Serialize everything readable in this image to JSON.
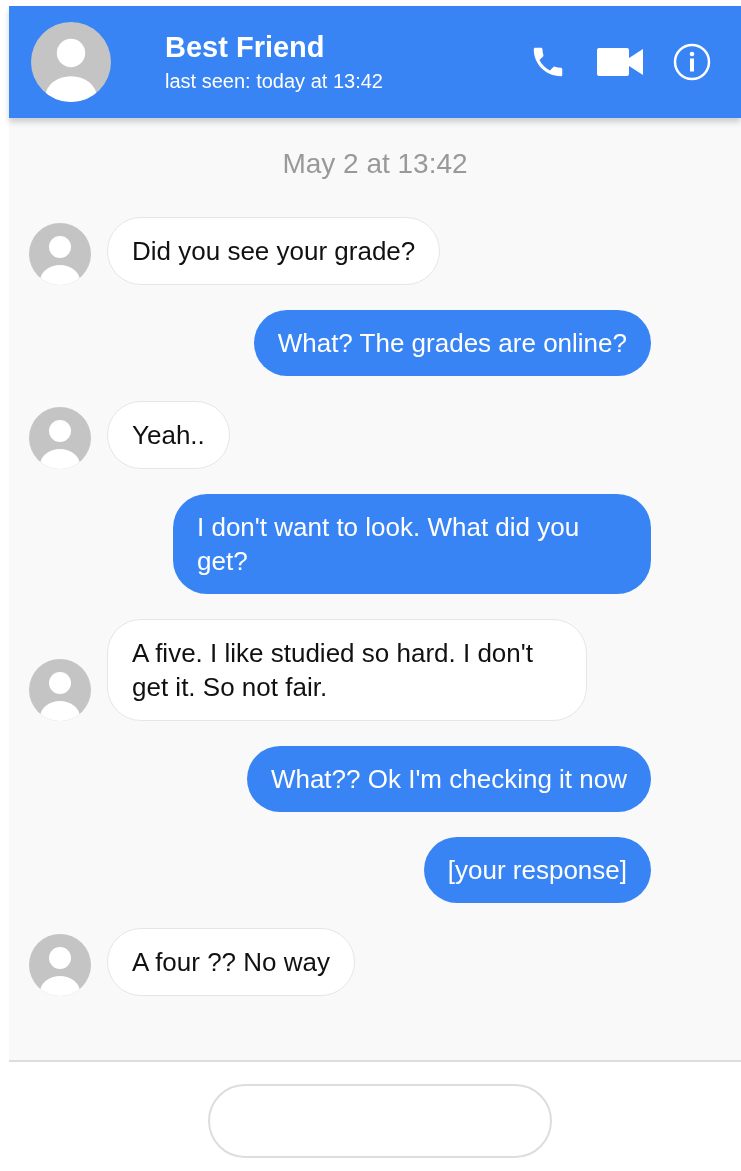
{
  "header": {
    "name": "Best Friend",
    "status": "last seen: today at 13:42"
  },
  "date": "May 2 at 13:42",
  "messages": [
    {
      "kind": "received",
      "text": "Did you see your grade?"
    },
    {
      "kind": "sent",
      "text": "What? The grades are online?"
    },
    {
      "kind": "received",
      "text": "Yeah.."
    },
    {
      "kind": "sent",
      "text": "I don't want to look. What did you get?"
    },
    {
      "kind": "received",
      "text": "A five. I like studied so hard. I don't get it. So not fair."
    },
    {
      "kind": "sent",
      "text": "What?? Ok I'm checking it now"
    },
    {
      "kind": "sent",
      "text": "[your response]"
    },
    {
      "kind": "received",
      "text": "A four ?? No way"
    }
  ]
}
